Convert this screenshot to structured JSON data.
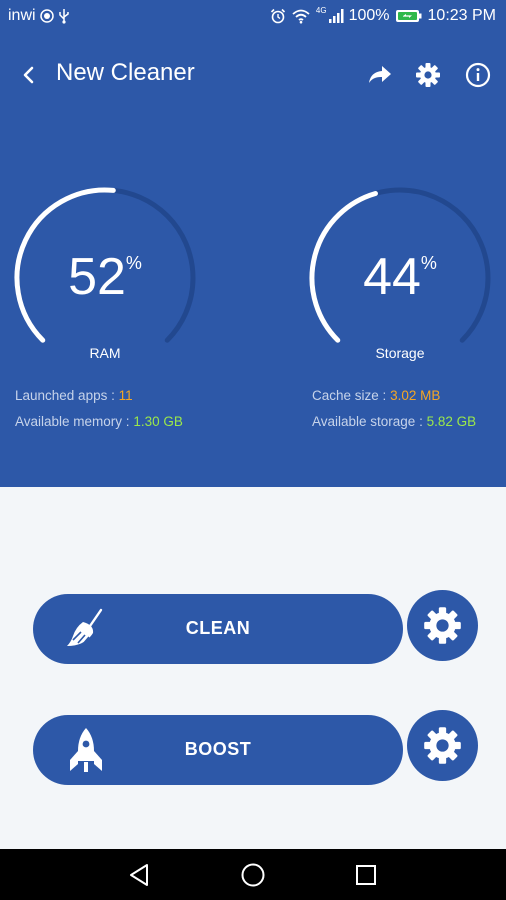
{
  "status_bar": {
    "carrier": "inwi",
    "network_label": "4G",
    "battery_percent": "100%",
    "time": "10:23 PM",
    "icons": [
      "record-icon",
      "usb-icon",
      "alarm-icon",
      "wifi-icon",
      "signal-icon",
      "battery-charging-icon"
    ]
  },
  "appbar": {
    "title": "New Cleaner",
    "actions": [
      "share-icon",
      "settings-icon",
      "info-icon"
    ]
  },
  "gauges": {
    "ram": {
      "value": "52",
      "unit": "%",
      "label": "RAM",
      "fraction": 0.52
    },
    "storage": {
      "value": "44",
      "unit": "%",
      "label": "Storage",
      "fraction": 0.44
    }
  },
  "info": {
    "launched_apps_label": "Launched apps :",
    "launched_apps_value": "11",
    "available_memory_label": "Available memory :",
    "available_memory_value": "1.30 GB",
    "cache_size_label": "Cache size :",
    "cache_size_value": "3.02 MB",
    "available_storage_label": "Available storage :",
    "available_storage_value": "5.82 GB"
  },
  "actions": {
    "clean_label": "CLEAN",
    "boost_label": "BOOST"
  },
  "colors": {
    "primary": "#2d58a8",
    "background": "#f3f6f9",
    "orange_value": "#f5a623",
    "green_value": "#9be84a"
  }
}
